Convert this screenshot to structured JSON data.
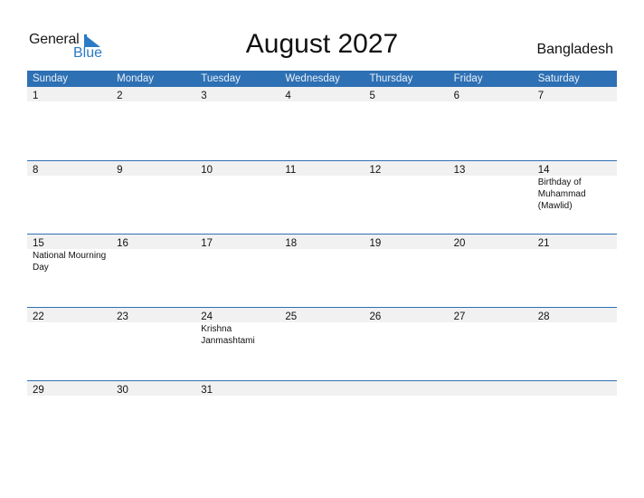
{
  "logo": {
    "word1": "General",
    "word2": "Blue"
  },
  "title": "August 2027",
  "country": "Bangladesh",
  "colors": {
    "header_bg": "#2e70b4",
    "date_strip_bg": "#f1f1f1",
    "logo_blue": "#2a7bc4"
  },
  "weekdays": [
    "Sunday",
    "Monday",
    "Tuesday",
    "Wednesday",
    "Thursday",
    "Friday",
    "Saturday"
  ],
  "weeks": [
    {
      "days": [
        "1",
        "2",
        "3",
        "4",
        "5",
        "6",
        "7"
      ],
      "events": [
        "",
        "",
        "",
        "",
        "",
        "",
        ""
      ]
    },
    {
      "days": [
        "8",
        "9",
        "10",
        "11",
        "12",
        "13",
        "14"
      ],
      "events": [
        "",
        "",
        "",
        "",
        "",
        "",
        "Birthday of Muhammad (Mawlid)"
      ]
    },
    {
      "days": [
        "15",
        "16",
        "17",
        "18",
        "19",
        "20",
        "21"
      ],
      "events": [
        "National Mourning Day",
        "",
        "",
        "",
        "",
        "",
        ""
      ]
    },
    {
      "days": [
        "22",
        "23",
        "24",
        "25",
        "26",
        "27",
        "28"
      ],
      "events": [
        "",
        "",
        "Krishna Janmashtami",
        "",
        "",
        "",
        ""
      ]
    },
    {
      "days": [
        "29",
        "30",
        "31",
        "",
        "",
        "",
        ""
      ],
      "events": [
        "",
        "",
        "",
        "",
        "",
        "",
        ""
      ]
    }
  ]
}
